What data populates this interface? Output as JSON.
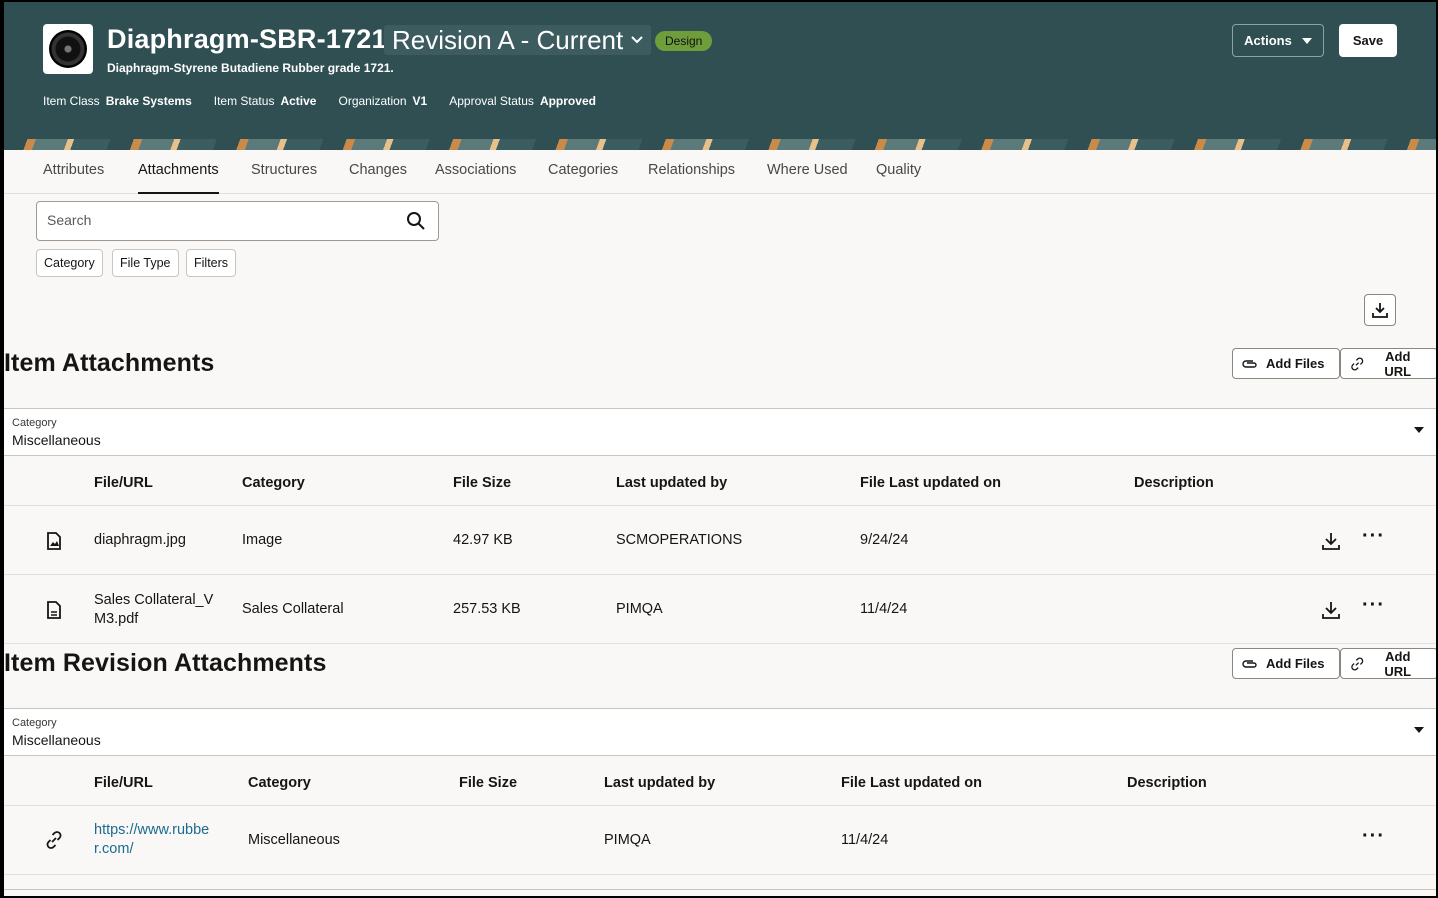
{
  "header": {
    "title": "Diaphragm-SBR-1721",
    "revision": "Revision A - Current",
    "badge": "Design",
    "subtitle": "Diaphragm-Styrene Butadiene Rubber grade 1721.",
    "meta": [
      {
        "key": "Item Class",
        "value": "Brake Systems"
      },
      {
        "key": "Item Status",
        "value": "Active"
      },
      {
        "key": "Organization",
        "value": "V1"
      },
      {
        "key": "Approval Status",
        "value": "Approved"
      }
    ],
    "actions_label": "Actions",
    "save_label": "Save",
    "thumbnail_icon": "diaphragm-thumbnail",
    "colors": {
      "header_bg": "#2f4f53",
      "badge": "#6e9d3c"
    }
  },
  "tabs": [
    "Attributes",
    "Attachments",
    "Structures",
    "Changes",
    "Associations",
    "Categories",
    "Relationships",
    "Where Used",
    "Quality"
  ],
  "active_tab": "Attachments",
  "search": {
    "placeholder": "Search"
  },
  "filters": [
    "Category",
    "File Type",
    "Filters"
  ],
  "item_attachments": {
    "title": "Item Attachments",
    "add_files": "Add Files",
    "add_url": "Add URL",
    "category_label": "Category",
    "category_value": "Miscellaneous",
    "columns": [
      "File/URL",
      "Category",
      "File Size",
      "Last updated by",
      "File Last updated on",
      "Description"
    ],
    "rows": [
      {
        "icon": "image-file-icon",
        "file_a": "diaphragm.jpg",
        "file_b": "",
        "category": "Image",
        "size": "42.97 KB",
        "updated_by": "SCMOPERATIONS",
        "updated_on": "9/24/24",
        "description": ""
      },
      {
        "icon": "pdf-file-icon",
        "file_a": "Sales Collateral_V",
        "file_b": "M3.pdf",
        "category": "Sales Collateral",
        "size": "257.53 KB",
        "updated_by": "PIMQA",
        "updated_on": "11/4/24",
        "description": ""
      }
    ]
  },
  "revision_attachments": {
    "title": "Item Revision Attachments",
    "add_files": "Add Files",
    "add_url": "Add URL",
    "category_label": "Category",
    "category_value": "Miscellaneous",
    "columns": [
      "File/URL",
      "Category",
      "File Size",
      "Last updated by",
      "File Last updated on",
      "Description"
    ],
    "rows": [
      {
        "icon": "link-icon",
        "file_a": "https://www.rubbe",
        "file_b": "r.com/",
        "category": "Miscellaneous",
        "size": "",
        "updated_by": "PIMQA",
        "updated_on": "11/4/24",
        "description": ""
      }
    ]
  }
}
